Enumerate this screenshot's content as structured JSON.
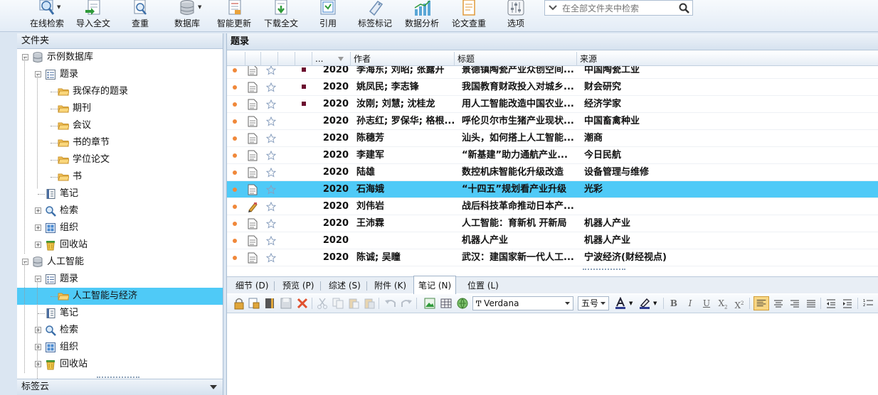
{
  "toolbar": {
    "items": [
      {
        "label": "在线检索",
        "icon": "magnifier-globe-icon"
      },
      {
        "label": "导入全文",
        "icon": "import-document-icon"
      },
      {
        "label": "查重",
        "icon": "duplicate-check-icon"
      },
      {
        "label": "数据库",
        "icon": "database-icon"
      },
      {
        "label": "智能更新",
        "icon": "smart-update-icon"
      },
      {
        "label": "下载全文",
        "icon": "download-document-icon"
      },
      {
        "label": "引用",
        "icon": "cite-icon"
      },
      {
        "label": "标签标记",
        "icon": "tag-icon"
      },
      {
        "label": "数据分析",
        "icon": "bar-chart-icon"
      },
      {
        "label": "论文查重",
        "icon": "paper-check-icon"
      },
      {
        "label": "选项",
        "icon": "options-sliders-icon"
      }
    ],
    "search_placeholder": "在全部文件夹中检索"
  },
  "left_panel": {
    "title": "文件夹",
    "tree": [
      {
        "label": "示例数据库",
        "level": 0,
        "icon": "database-icon",
        "toggle": "⊟"
      },
      {
        "label": "题录",
        "level": 1,
        "icon": "list-icon",
        "toggle": "⊟"
      },
      {
        "label": "我保存的题录",
        "level": 2,
        "icon": "folder-icon"
      },
      {
        "label": "期刊",
        "level": 2,
        "icon": "folder-icon"
      },
      {
        "label": "会议",
        "level": 2,
        "icon": "folder-icon"
      },
      {
        "label": "书的章节",
        "level": 2,
        "icon": "folder-icon"
      },
      {
        "label": "学位论文",
        "level": 2,
        "icon": "folder-icon"
      },
      {
        "label": "书",
        "level": 2,
        "icon": "folder-icon"
      },
      {
        "label": "笔记",
        "level": 1,
        "icon": "notebook-icon"
      },
      {
        "label": "检索",
        "level": 1,
        "icon": "search-icon",
        "toggle": "⊞"
      },
      {
        "label": "组织",
        "level": 1,
        "icon": "organize-icon",
        "toggle": "⊞"
      },
      {
        "label": "回收站",
        "level": 1,
        "icon": "recycle-bin-icon",
        "toggle": "⊞"
      },
      {
        "label": "人工智能",
        "level": 0,
        "icon": "database-icon",
        "toggle": "⊟"
      },
      {
        "label": "题录",
        "level": 1,
        "icon": "list-icon",
        "toggle": "⊟"
      },
      {
        "label": "人工智能与经济",
        "level": 2,
        "icon": "folder-icon",
        "selected": true
      },
      {
        "label": "笔记",
        "level": 1,
        "icon": "notebook-icon"
      },
      {
        "label": "检索",
        "level": 1,
        "icon": "search-icon",
        "toggle": "⊞"
      },
      {
        "label": "组织",
        "level": 1,
        "icon": "organize-icon",
        "toggle": "⊞"
      },
      {
        "label": "回收站",
        "level": 1,
        "icon": "recycle-bin-icon",
        "toggle": "⊞"
      }
    ],
    "tag_cloud": "标签云"
  },
  "right_panel": {
    "title": "题录",
    "columns": {
      "year": "...",
      "author": "作者",
      "title": "标题",
      "source": "来源"
    },
    "rows": [
      {
        "year": "2020",
        "author": "李海东; 刘昭; 张露开",
        "title": "景德镇陶瓷产业众创空间...",
        "source": "中国陶瓷工业",
        "flag": true,
        "attach": "doc"
      },
      {
        "year": "2020",
        "author": "姚凤民; 李志锋",
        "title": "我国教育财政投入对城乡...",
        "source": "财会研究",
        "flag": true,
        "attach": "doc"
      },
      {
        "year": "2020",
        "author": "汝刚; 刘慧; 沈桂龙",
        "title": "用人工智能改造中国农业...",
        "source": "经济学家",
        "flag": true,
        "attach": "doc"
      },
      {
        "year": "2020",
        "author": "孙志红; 罗保华; 格根...",
        "title": "呼伦贝尔市生猪产业现状...",
        "source": "中国畜禽种业",
        "attach": "doc"
      },
      {
        "year": "2020",
        "author": "陈穗芳",
        "title": "汕头，如何搭上人工智能...",
        "source": "潮商",
        "attach": "doc"
      },
      {
        "year": "2020",
        "author": "李建军",
        "title": "“新基建”助力通航产业...",
        "source": "今日民航",
        "attach": "doc"
      },
      {
        "year": "2020",
        "author": "陆雄",
        "title": "数控机床智能化升级改造",
        "source": "设备管理与维修",
        "attach": "doc"
      },
      {
        "year": "2020",
        "author": "石海娥",
        "title": "“十四五”规划看产业升级",
        "source": "光彩",
        "attach": "doc",
        "selected": true
      },
      {
        "year": "2020",
        "author": "刘伟岩",
        "title": "战后科技革命推动日本产...",
        "source": "",
        "attach": "edit"
      },
      {
        "year": "2020",
        "author": "王沛霖",
        "title": "人工智能：育新机 开新局",
        "source": "机器人产业",
        "attach": "doc"
      },
      {
        "year": "2020",
        "author": "",
        "title": "机器人产业",
        "source": "机器人产业",
        "attach": "doc"
      },
      {
        "year": "2020",
        "author": "陈诚; 吴瞳",
        "title": "武汉：建国家新一代人工...",
        "source": "宁波经济(财经视点)",
        "attach": "doc"
      }
    ],
    "tabs": [
      {
        "label": "细节 (D)"
      },
      {
        "label": "预览 (P)"
      },
      {
        "label": "综述 (S)"
      },
      {
        "label": "附件 (K)"
      },
      {
        "label": "笔记 (N)",
        "active": true
      },
      {
        "label": "位置 (L)"
      }
    ],
    "editor": {
      "font_name": "Verdana",
      "font_size": "五号",
      "fmt_bold": "B",
      "fmt_italic": "I",
      "fmt_underline": "U",
      "fmt_sub": "X",
      "fmt_sub_mark": "2",
      "fmt_sup": "X",
      "fmt_sup_mark": "2"
    }
  },
  "colors": {
    "selection": "#4fcaf7",
    "accent_flag": "#6b0e2f",
    "status_dot": "#f0883a"
  }
}
